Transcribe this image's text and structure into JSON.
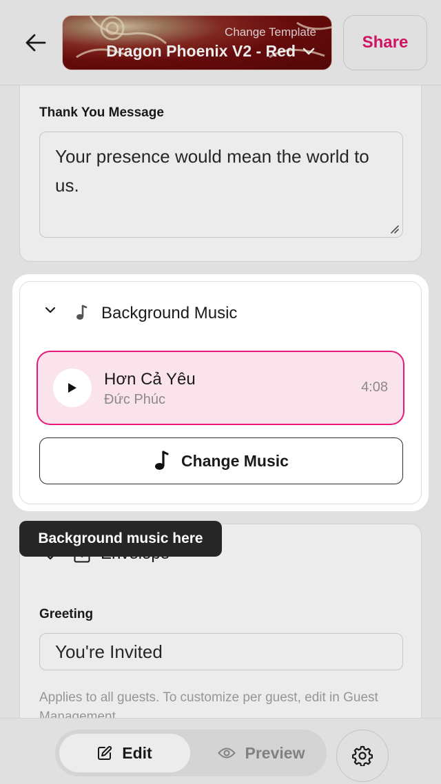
{
  "header": {
    "template_subtitle": "Change Template",
    "template_name": "Dragon Phoenix V2 - Red",
    "share_label": "Share"
  },
  "thank_you": {
    "label": "Thank You Message",
    "value": "Your presence would mean the world to us."
  },
  "music": {
    "section_title": "Background Music",
    "track": {
      "title": "Hơn Cả Yêu",
      "artist": "Đức Phúc",
      "duration": "4:08"
    },
    "change_label": "Change Music"
  },
  "tooltip": {
    "text": "Background music here"
  },
  "envelope": {
    "section_title": "Envelope",
    "greeting_label": "Greeting",
    "greeting_value": "You're Invited",
    "helper_text": "Applies to all guests. To customize per guest, edit in Guest Management."
  },
  "bottom_bar": {
    "edit_label": "Edit",
    "preview_label": "Preview"
  },
  "colors": {
    "accent": "#e8187a",
    "share_text": "#e0156c",
    "track_bg": "#fbe3ec",
    "tooltip_bg": "#262626"
  },
  "icons": [
    "arrow-left-icon",
    "chevron-down-icon",
    "music-note-icon",
    "play-icon",
    "edit-icon",
    "eye-icon",
    "gear-icon"
  ]
}
